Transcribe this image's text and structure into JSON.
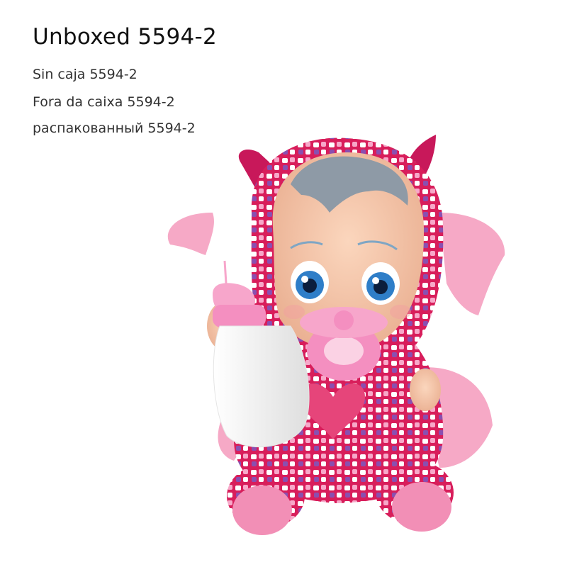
{
  "caption": {
    "title": "Unboxed 5594-2",
    "lines": [
      "Sin caja 5594-2",
      "Fora da caixa 5594-2",
      "распакованный 5594-2"
    ]
  },
  "colors": {
    "background": "#ffffff",
    "suit": "#d81e5b",
    "wings": "#f6a9c6",
    "skin": "#f6c6a8",
    "hair": "#8e9aa6",
    "pacifier": "#f48fc0",
    "bottle": "#f5f5f5",
    "eyes": "#2f7ec8"
  }
}
